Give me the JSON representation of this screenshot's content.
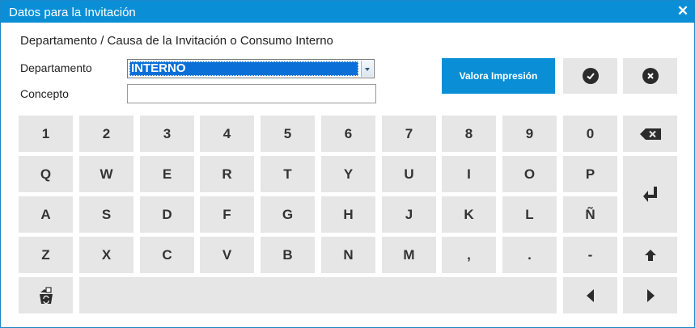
{
  "window": {
    "title": "Datos para la Invitación",
    "close_glyph": "✕"
  },
  "form": {
    "heading": "Departamento / Causa de la Invitación o Consumo Interno",
    "departamento_label": "Departamento",
    "departamento_value": "INTERNO",
    "concepto_label": "Concepto",
    "concepto_value": ""
  },
  "actions": {
    "valora_label": "Valora Impresión",
    "confirm_icon": "check-circle-icon",
    "cancel_icon": "close-circle-icon"
  },
  "keyboard": {
    "row1": [
      "1",
      "2",
      "3",
      "4",
      "5",
      "6",
      "7",
      "8",
      "9",
      "0"
    ],
    "row2": [
      "Q",
      "W",
      "E",
      "R",
      "T",
      "Y",
      "U",
      "I",
      "O",
      "P"
    ],
    "row3": [
      "A",
      "S",
      "D",
      "F",
      "G",
      "H",
      "J",
      "K",
      "L",
      "Ñ"
    ],
    "row4": [
      "Z",
      "X",
      "C",
      "V",
      "B",
      "N",
      "M",
      ",",
      ".",
      "-"
    ],
    "special_icons": {
      "backspace": "backspace-icon",
      "enter": "enter-icon",
      "shift": "shift-up-arrow-icon",
      "recycle": "recycle-bin-icon",
      "left": "left-arrow-icon",
      "right": "right-arrow-icon"
    }
  },
  "colors": {
    "accent": "#0a8fd6",
    "key_bg": "#e6e6e6",
    "selected_bg": "#0a6fd6"
  }
}
